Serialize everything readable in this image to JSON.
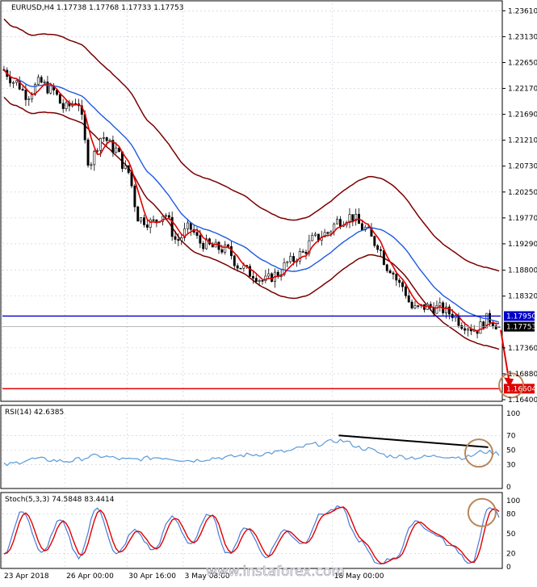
{
  "colors": {
    "background": "#ffffff",
    "grid": "#c8c8d8",
    "border": "#000000",
    "candle_bull": "#ffffff",
    "candle_bear": "#000000",
    "ma_fast": "#e00000",
    "ma_slow": "#1e5ae0",
    "envelope": "#7a0000",
    "resistance": "#0000cc",
    "target": "#e00000",
    "rsi_line": "#5a9ad8",
    "stoch_main": "#4a7ad8",
    "stoch_signal": "#e00000",
    "annotation_circle": "#b8865a",
    "trend_line": "#000000"
  },
  "main_panel": {
    "header": "EURUSD,H4  1.17738 1.17768 1.17733 1.17753",
    "price_ticks": [
      "1.23610",
      "1.23130",
      "1.22650",
      "1.22170",
      "1.21690",
      "1.21210",
      "1.20730",
      "1.20250",
      "1.19770",
      "1.19290",
      "1.18800",
      "1.18320",
      "1.17360",
      "1.16880",
      "1.16400"
    ],
    "level_resistance_label": "1.17950",
    "level_current_label": "1.17753",
    "level_target_label": "1.16604"
  },
  "rsi_panel": {
    "header": "RSI(14) 42.6385",
    "ticks": [
      "100",
      "70",
      "50",
      "30",
      "0"
    ]
  },
  "stoch_panel": {
    "header": "Stoch(5,3,3) 74.5848 83.4414",
    "ticks": [
      "100",
      "80",
      "50",
      "20",
      "0"
    ]
  },
  "x_axis": {
    "labels": [
      "23 Apr 2018",
      "26 Apr 00:00",
      "30 Apr 16:00",
      "3 May 08:00",
      "18 May 00:00"
    ]
  },
  "watermark": "www.instaforex.com",
  "chart_data": {
    "type": "candlestick",
    "symbol": "EURUSD",
    "timeframe": "H4",
    "ohlc_last": {
      "open": 1.17738,
      "high": 1.17768,
      "low": 1.17733,
      "close": 1.17753
    },
    "ylim": [
      1.164,
      1.2375
    ],
    "x_range_bars": [
      0,
      160
    ],
    "path_anchors": [
      [
        0,
        1.2252
      ],
      [
        4,
        1.2229
      ],
      [
        8,
        1.2205
      ],
      [
        12,
        1.2228
      ],
      [
        16,
        1.2213
      ],
      [
        20,
        1.218
      ],
      [
        24,
        1.2195
      ],
      [
        28,
        1.208
      ],
      [
        32,
        1.2128
      ],
      [
        36,
        1.2105
      ],
      [
        40,
        1.2065
      ],
      [
        44,
        1.1975
      ],
      [
        48,
        1.1968
      ],
      [
        52,
        1.1985
      ],
      [
        56,
        1.1935
      ],
      [
        60,
        1.1958
      ],
      [
        64,
        1.193
      ],
      [
        68,
        1.1922
      ],
      [
        72,
        1.1918
      ],
      [
        76,
        1.1888
      ],
      [
        80,
        1.1874
      ],
      [
        84,
        1.186
      ],
      [
        88,
        1.1872
      ],
      [
        92,
        1.1895
      ],
      [
        96,
        1.191
      ],
      [
        100,
        1.1938
      ],
      [
        104,
        1.1948
      ],
      [
        108,
        1.1972
      ],
      [
        112,
        1.198
      ],
      [
        116,
        1.1958
      ],
      [
        120,
        1.193
      ],
      [
        124,
        1.1885
      ],
      [
        128,
        1.1852
      ],
      [
        132,
        1.1808
      ],
      [
        136,
        1.1812
      ],
      [
        140,
        1.181
      ],
      [
        144,
        1.18
      ],
      [
        148,
        1.178
      ],
      [
        152,
        1.177
      ],
      [
        156,
        1.179
      ],
      [
        160,
        1.1775
      ]
    ],
    "levels": [
      {
        "name": "resistance",
        "value": 1.1795
      },
      {
        "name": "current",
        "value": 1.17753
      },
      {
        "name": "target",
        "value": 1.16604
      }
    ],
    "rsi": {
      "period": 14,
      "last": 42.6385,
      "levels": [
        70,
        50,
        30
      ],
      "anchors": [
        [
          0,
          30
        ],
        [
          10,
          38
        ],
        [
          20,
          35
        ],
        [
          30,
          42
        ],
        [
          40,
          37
        ],
        [
          50,
          40
        ],
        [
          60,
          36
        ],
        [
          70,
          40
        ],
        [
          80,
          44
        ],
        [
          90,
          48
        ],
        [
          100,
          58
        ],
        [
          108,
          63
        ],
        [
          116,
          52
        ],
        [
          124,
          42
        ],
        [
          132,
          40
        ],
        [
          140,
          42
        ],
        [
          148,
          40
        ],
        [
          154,
          48
        ],
        [
          158,
          46
        ],
        [
          160,
          43
        ]
      ]
    },
    "stoch": {
      "params": "5,3,3",
      "main_last": 74.5848,
      "signal_last": 83.4414,
      "levels": [
        80,
        50,
        20
      ],
      "cycle_points": [
        [
          0,
          20
        ],
        [
          6,
          85
        ],
        [
          12,
          20
        ],
        [
          18,
          70
        ],
        [
          24,
          15
        ],
        [
          30,
          90
        ],
        [
          36,
          18
        ],
        [
          42,
          55
        ],
        [
          48,
          25
        ],
        [
          54,
          75
        ],
        [
          60,
          35
        ],
        [
          66,
          80
        ],
        [
          72,
          20
        ],
        [
          78,
          60
        ],
        [
          84,
          15
        ],
        [
          90,
          55
        ],
        [
          96,
          35
        ],
        [
          102,
          80
        ],
        [
          108,
          90
        ],
        [
          114,
          40
        ],
        [
          120,
          5
        ],
        [
          126,
          15
        ],
        [
          132,
          70
        ],
        [
          138,
          50
        ],
        [
          144,
          30
        ],
        [
          150,
          5
        ],
        [
          156,
          90
        ],
        [
          160,
          85
        ]
      ]
    }
  }
}
